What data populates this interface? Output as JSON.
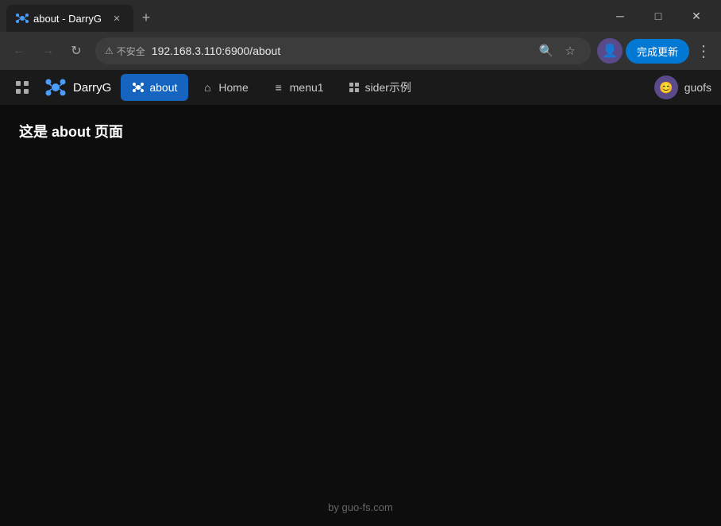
{
  "browser": {
    "tab": {
      "title": "about - DarryG",
      "favicon": "◆"
    },
    "new_tab_label": "+",
    "window_controls": {
      "minimize": "─",
      "maximize": "□",
      "close": "✕"
    },
    "address_bar": {
      "back_icon": "←",
      "forward_icon": "→",
      "refresh_icon": "↺",
      "security_text": "不安全",
      "url": "192.168.3.110:6900/about",
      "search_icon": "🔍",
      "bookmark_icon": "☆",
      "profile_icon": "👤",
      "update_button": "完成更新",
      "menu_icon": "⋮"
    }
  },
  "app_nav": {
    "grid_icon": "⊞",
    "logo_text": "DarryG",
    "nav_items": [
      {
        "id": "about",
        "label": "about",
        "active": true,
        "icon": "◆"
      },
      {
        "id": "home",
        "label": "Home",
        "active": false,
        "icon": "⌂"
      },
      {
        "id": "menu1",
        "label": "menu1",
        "active": false,
        "icon": "≡"
      },
      {
        "id": "sider",
        "label": "sider示例",
        "active": false,
        "icon": "⊞"
      }
    ],
    "user": {
      "avatar": "😊",
      "name": "guofs"
    }
  },
  "page": {
    "heading": "这是 about 页面",
    "footer": "by guo-fs.com"
  }
}
